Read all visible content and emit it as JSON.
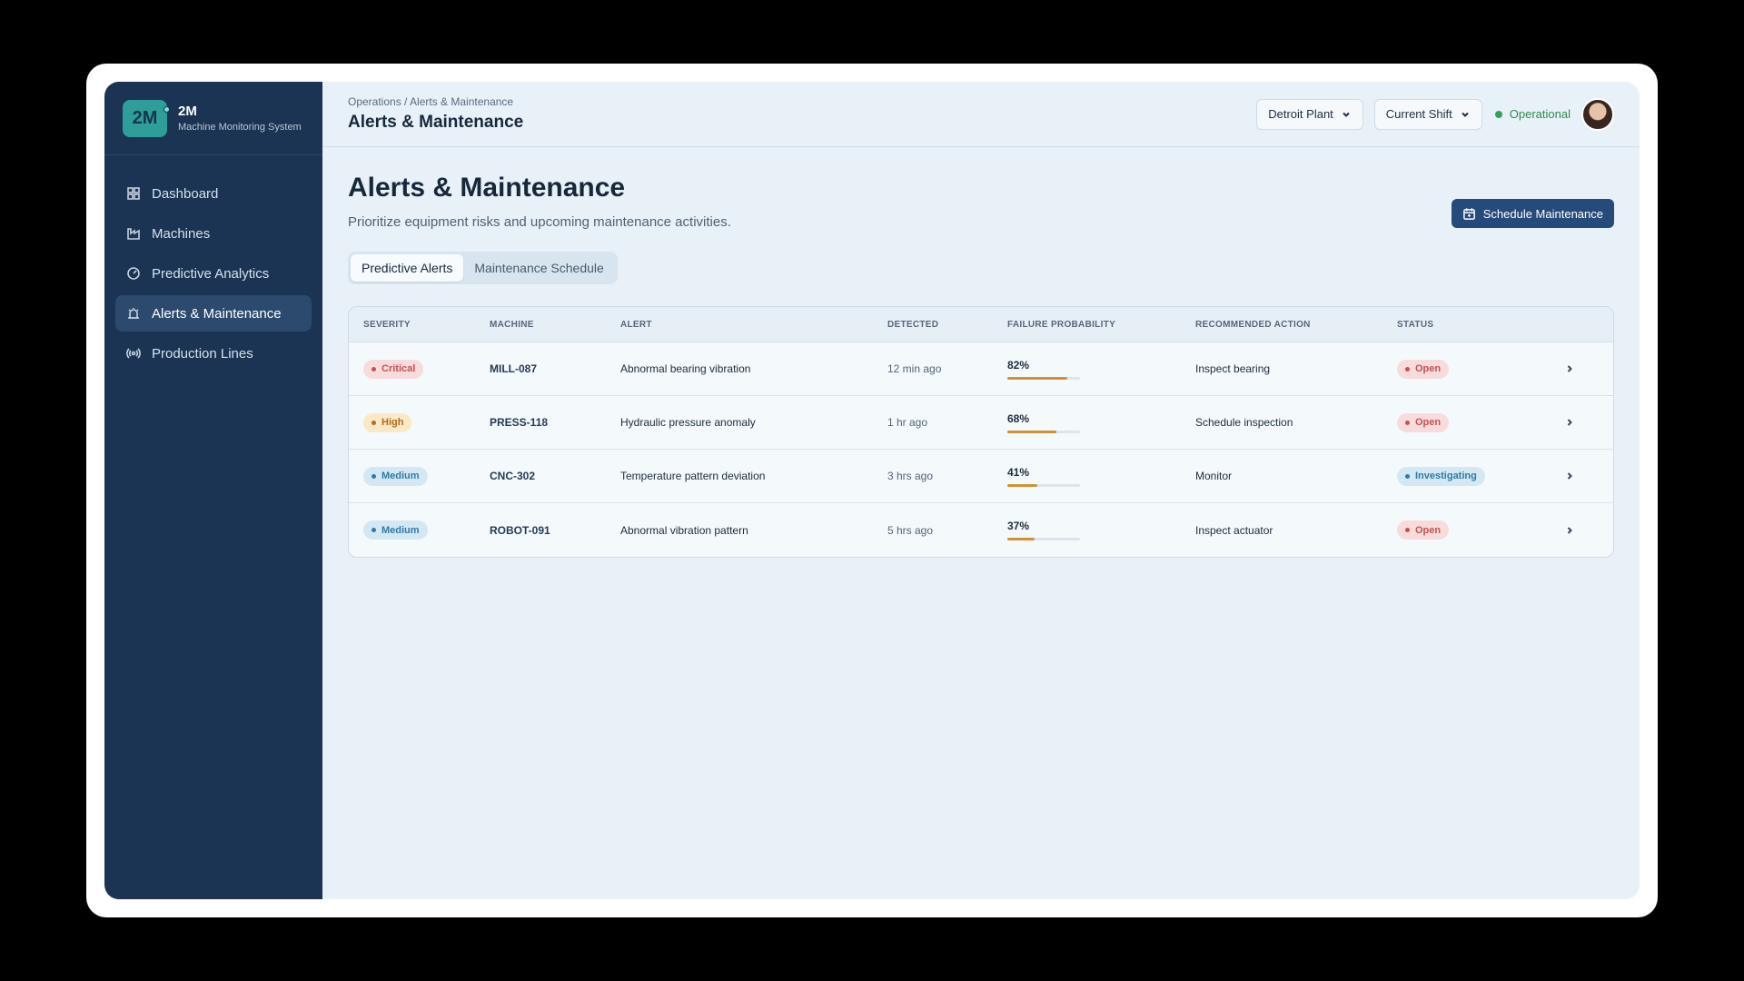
{
  "brand": {
    "logo": "2M",
    "name": "2M",
    "subtitle": "Machine Monitoring System"
  },
  "sidebar": {
    "items": [
      {
        "label": "Dashboard",
        "icon": "grid-icon",
        "active": false
      },
      {
        "label": "Machines",
        "icon": "factory-icon",
        "active": false
      },
      {
        "label": "Predictive Analytics",
        "icon": "gauge-icon",
        "active": false
      },
      {
        "label": "Alerts & Maintenance",
        "icon": "alarm-icon",
        "active": true
      },
      {
        "label": "Production Lines",
        "icon": "broadcast-icon",
        "active": false
      }
    ]
  },
  "header": {
    "breadcrumb": "Operations / Alerts & Maintenance",
    "title": "Alerts & Maintenance",
    "plant_select": "Detroit Plant",
    "shift_select": "Current Shift",
    "status": "Operational"
  },
  "page": {
    "title": "Alerts & Maintenance",
    "subtitle": "Prioritize equipment risks and upcoming maintenance activities.",
    "schedule_button": "Schedule Maintenance",
    "tabs": [
      {
        "label": "Predictive Alerts",
        "active": true
      },
      {
        "label": "Maintenance Schedule",
        "active": false
      }
    ]
  },
  "table": {
    "columns": [
      "SEVERITY",
      "MACHINE",
      "ALERT",
      "DETECTED",
      "FAILURE PROBABILITY",
      "RECOMMENDED ACTION",
      "STATUS"
    ],
    "rows": [
      {
        "severity": "Critical",
        "severity_key": "critical",
        "machine": "MILL-087",
        "alert": "Abnormal bearing vibration",
        "detected": "12 min ago",
        "probability": "82%",
        "probability_value": 0.82,
        "action": "Inspect bearing",
        "status": "Open",
        "status_key": "open"
      },
      {
        "severity": "High",
        "severity_key": "high",
        "machine": "PRESS-118",
        "alert": "Hydraulic pressure anomaly",
        "detected": "1 hr ago",
        "probability": "68%",
        "probability_value": 0.68,
        "action": "Schedule inspection",
        "status": "Open",
        "status_key": "open"
      },
      {
        "severity": "Medium",
        "severity_key": "medium",
        "machine": "CNC-302",
        "alert": "Temperature pattern deviation",
        "detected": "3 hrs ago",
        "probability": "41%",
        "probability_value": 0.41,
        "action": "Monitor",
        "status": "Investigating",
        "status_key": "investigating"
      },
      {
        "severity": "Medium",
        "severity_key": "medium",
        "machine": "ROBOT-091",
        "alert": "Abnormal vibration pattern",
        "detected": "5 hrs ago",
        "probability": "37%",
        "probability_value": 0.37,
        "action": "Inspect actuator",
        "status": "Open",
        "status_key": "open"
      }
    ]
  },
  "colors": {
    "sidebar": "#1b3453",
    "accent": "#264a7a",
    "brand_teal": "#2f9e9a",
    "probability_bar": "#d19236",
    "status_ok": "#2fa35a"
  }
}
